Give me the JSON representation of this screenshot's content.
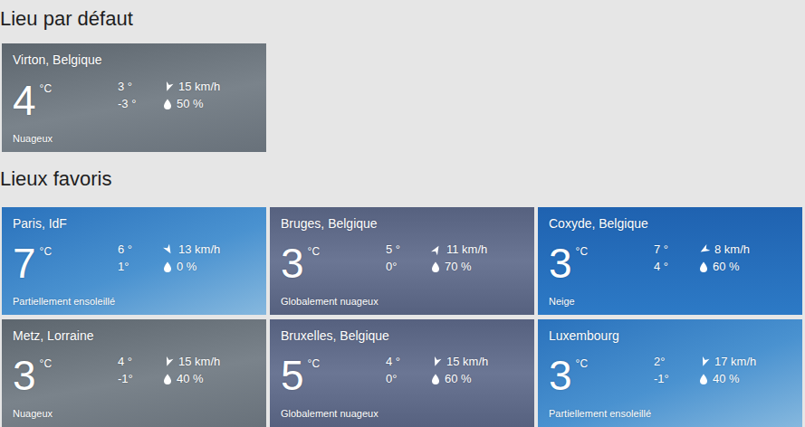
{
  "default_location": {
    "heading": "Lieu par défaut",
    "card": {
      "city": "Virton, Belgique",
      "temp": "4",
      "unit": "°C",
      "high": "3 °",
      "low": "-3 °",
      "wind": "15 km/h",
      "wind_angle": 200,
      "humidity": "50 %",
      "condition": "Nuageux",
      "kind": "cloudy"
    }
  },
  "favorites": {
    "heading": "Lieux favoris",
    "cards": [
      {
        "city": "Paris, IdF",
        "temp": "7",
        "unit": "°C",
        "high": "6 °",
        "low": "1°",
        "wind": "13 km/h",
        "wind_angle": 150,
        "humidity": "0 %",
        "condition": "Partiellement ensoleillé",
        "kind": "sunny"
      },
      {
        "city": "Bruges, Belgique",
        "temp": "3",
        "unit": "°C",
        "high": "5 °",
        "low": "0°",
        "wind": "11 km/h",
        "wind_angle": 30,
        "humidity": "70 %",
        "condition": "Globalement nuageux",
        "kind": "overcast"
      },
      {
        "city": "Coxyde, Belgique",
        "temp": "3",
        "unit": "°C",
        "high": "7 °",
        "low": "4 °",
        "wind": "8 km/h",
        "wind_angle": 240,
        "humidity": "60 %",
        "condition": "Neige",
        "kind": "snow"
      },
      {
        "city": "Metz, Lorraine",
        "temp": "3",
        "unit": "°C",
        "high": "4 °",
        "low": "-1°",
        "wind": "15 km/h",
        "wind_angle": 200,
        "humidity": "40 %",
        "condition": "Nuageux",
        "kind": "cloudy"
      },
      {
        "city": "Bruxelles, Belgique",
        "temp": "5",
        "unit": "°C",
        "high": "4 °",
        "low": "0°",
        "wind": "15 km/h",
        "wind_angle": 200,
        "humidity": "60 %",
        "condition": "Globalement nuageux",
        "kind": "overcast"
      },
      {
        "city": "Luxembourg",
        "temp": "3",
        "unit": "°C",
        "high": "2°",
        "low": "-1°",
        "wind": "17 km/h",
        "wind_angle": 200,
        "humidity": "40 %",
        "condition": "Partiellement ensoleillé",
        "kind": "sunny"
      }
    ]
  }
}
